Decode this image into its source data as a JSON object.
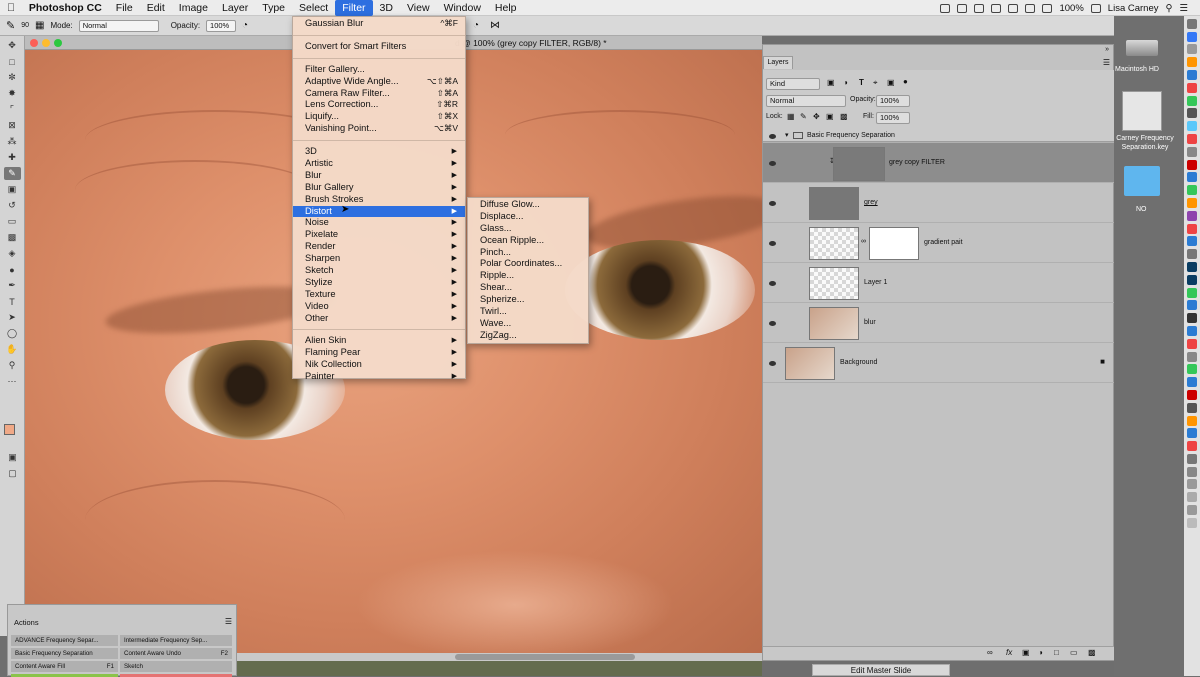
{
  "menubar": {
    "app": "Photoshop CC",
    "items": [
      "File",
      "Edit",
      "Image",
      "Layer",
      "Type",
      "Select",
      "Filter",
      "3D",
      "View",
      "Window",
      "Help"
    ],
    "active": "Filter",
    "battery": "100%",
    "user": "Lisa Carney"
  },
  "options": {
    "brush_size": "90",
    "mode_label": "Mode:",
    "mode_value": "Normal",
    "opacity_label": "Opacity:",
    "opacity_value": "100%"
  },
  "document": {
    "title": "d @ 100% (grey copy FILTER, RGB/8) *"
  },
  "filter_menu": {
    "last_filter": {
      "label": "Gaussian Blur",
      "shortcut": "^⌘F"
    },
    "smart": "Convert for Smart Filters",
    "group1": [
      {
        "label": "Filter Gallery...",
        "shortcut": ""
      },
      {
        "label": "Adaptive Wide Angle...",
        "shortcut": "⌥⇧⌘A"
      },
      {
        "label": "Camera Raw Filter...",
        "shortcut": "⇧⌘A"
      },
      {
        "label": "Lens Correction...",
        "shortcut": "⇧⌘R"
      },
      {
        "label": "Liquify...",
        "shortcut": "⇧⌘X"
      },
      {
        "label": "Vanishing Point...",
        "shortcut": "⌥⌘V"
      }
    ],
    "group2": [
      "3D",
      "Artistic",
      "Blur",
      "Blur Gallery",
      "Brush Strokes",
      "Distort",
      "Noise",
      "Pixelate",
      "Render",
      "Sharpen",
      "Sketch",
      "Stylize",
      "Texture",
      "Video",
      "Other"
    ],
    "group3": [
      "Alien Skin",
      "Flaming Pear",
      "Nik Collection",
      "Painter"
    ],
    "highlighted": "Distort"
  },
  "distort_submenu": [
    "Diffuse Glow...",
    "Displace...",
    "Glass...",
    "Ocean Ripple...",
    "Pinch...",
    "Polar Coordinates...",
    "Ripple...",
    "Shear...",
    "Spherize...",
    "Twirl...",
    "Wave...",
    "ZigZag..."
  ],
  "layers_panel": {
    "tab": "Layers",
    "kind_label": "Kind",
    "blend_mode": "Normal",
    "opacity_label": "Opacity:",
    "opacity_value": "100%",
    "lock_label": "Lock:",
    "fill_label": "Fill:",
    "fill_value": "100%",
    "group_name": "Basic Frequency Separation",
    "layers": [
      {
        "name": "grey copy FILTER",
        "selected": true
      },
      {
        "name": "grey",
        "selected": false
      },
      {
        "name": "gradient pait",
        "selected": false
      },
      {
        "name": "Layer 1",
        "selected": false
      },
      {
        "name": "blur",
        "selected": false
      },
      {
        "name": "Background",
        "selected": false
      }
    ]
  },
  "desktop": {
    "hd_label": "Macintosh HD",
    "file_label": "Carney Frequency Separation.key",
    "folder_label": "NO"
  },
  "actions_panel": {
    "title": "Actions",
    "buttons": [
      {
        "label": "ADVANCE Frequency Separ...",
        "key": ""
      },
      {
        "label": "Intermediate Frequency Sep...",
        "key": ""
      },
      {
        "label": "Basic Frequency Separation",
        "key": ""
      },
      {
        "label": "Content Aware Undo",
        "key": "F2"
      },
      {
        "label": "Content Aware Fill",
        "key": "F1"
      },
      {
        "label": "Sketch",
        "key": ""
      }
    ]
  },
  "footer": {
    "edit_master": "Edit Master Slide"
  },
  "colors": {
    "menu_highlight": "#2d6fe0",
    "menu_bg": "#f4dac8",
    "skin": "#de906b"
  }
}
